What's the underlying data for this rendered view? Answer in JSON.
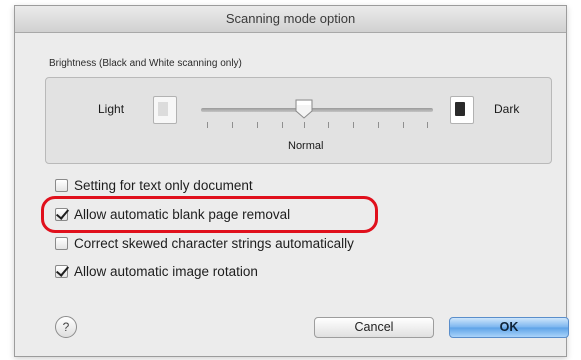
{
  "dialog": {
    "title": "Scanning mode option"
  },
  "brightness": {
    "group_label": "Brightness (Black and White scanning only)",
    "light_label": "Light",
    "dark_label": "Dark",
    "normal_label": "Normal",
    "level": 0.5
  },
  "options": [
    {
      "label": "Setting for text only document",
      "checked": false
    },
    {
      "label": "Allow automatic blank page removal",
      "checked": true,
      "highlighted": true
    },
    {
      "label": "Correct skewed character strings automatically",
      "checked": false
    },
    {
      "label": "Allow automatic image rotation",
      "checked": true
    }
  ],
  "buttons": {
    "help_label": "?",
    "cancel_label": "Cancel",
    "ok_label": "OK"
  },
  "colors": {
    "highlight": "#e0101c",
    "default_button": "#79b4ef"
  }
}
